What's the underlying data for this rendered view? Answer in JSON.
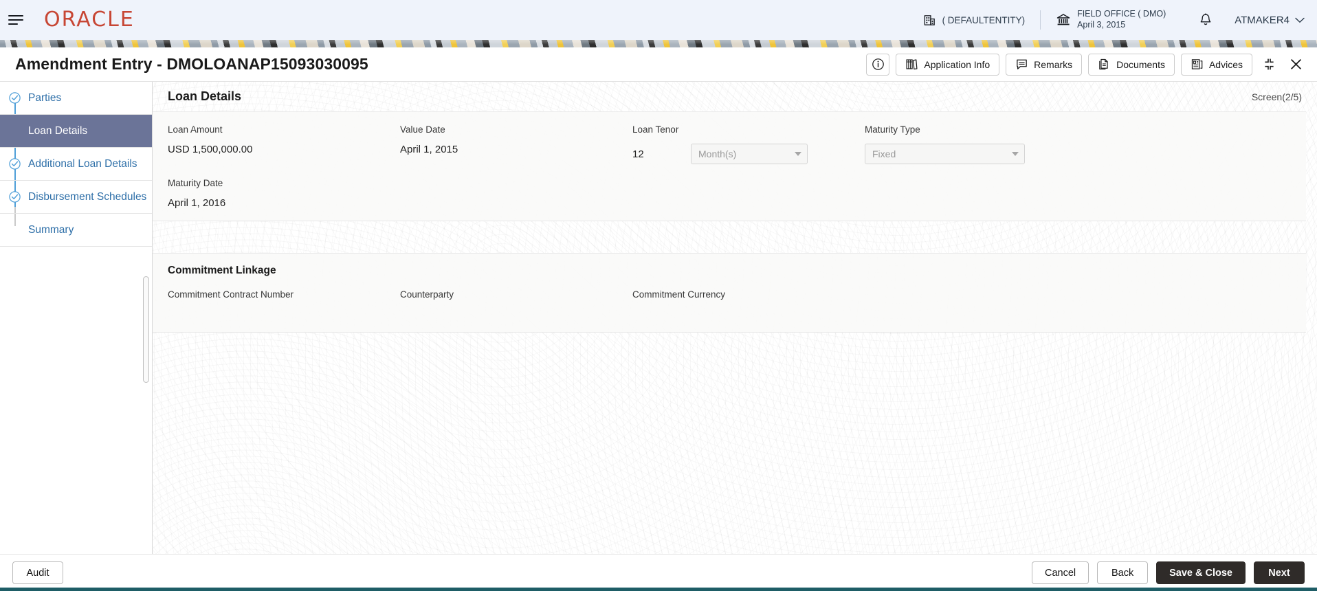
{
  "appbar": {
    "menu_icon": "hamburger-icon",
    "logo_text": "ORACLE",
    "entity": {
      "icon": "building-icon",
      "label": "( DEFAULTENTITY)"
    },
    "office": {
      "icon": "bank-icon",
      "name": "FIELD OFFICE ( DMO)",
      "date": "April 3, 2015"
    },
    "notifications_icon": "bell-icon",
    "user": {
      "name": "ATMAKER4",
      "caret_icon": "chevron-down-icon"
    }
  },
  "titlebar": {
    "title": "Amendment Entry - DMOLOANAP15093030095",
    "actions": [
      {
        "id": "info",
        "label": "",
        "icon": "info-circle-icon"
      },
      {
        "id": "application-info",
        "label": "Application Info",
        "icon": "books-icon"
      },
      {
        "id": "remarks",
        "label": "Remarks",
        "icon": "comment-icon"
      },
      {
        "id": "documents",
        "label": "Documents",
        "icon": "documents-icon"
      },
      {
        "id": "advices",
        "label": "Advices",
        "icon": "advices-icon"
      }
    ],
    "minimize_icon": "collapse-corners-icon",
    "close_icon": "close-icon"
  },
  "sidebar": {
    "items": [
      {
        "label": "Parties",
        "state": "complete"
      },
      {
        "label": "Loan Details",
        "state": "active"
      },
      {
        "label": "Additional Loan Details",
        "state": "complete"
      },
      {
        "label": "Disbursement Schedules",
        "state": "complete"
      },
      {
        "label": "Summary",
        "state": "pending"
      }
    ]
  },
  "main": {
    "section_title": "Loan Details",
    "screen_indicator": "Screen(2/5)",
    "loan_details": {
      "fields": [
        {
          "label": "Loan Amount",
          "value": "USD 1,500,000.00"
        },
        {
          "label": "Value Date",
          "value": "April 1, 2015"
        },
        {
          "label": "Loan Tenor",
          "value": "12",
          "unit_select": "Month(s)"
        },
        {
          "label": "Maturity Type",
          "select": "Fixed"
        },
        {
          "label": "Maturity Date",
          "value": "April 1, 2016"
        }
      ]
    },
    "commitment_linkage": {
      "heading": "Commitment Linkage",
      "fields": [
        {
          "label": "Commitment Contract Number",
          "value": ""
        },
        {
          "label": "Counterparty",
          "value": ""
        },
        {
          "label": "Commitment Currency",
          "value": ""
        }
      ]
    }
  },
  "footer": {
    "audit_label": "Audit",
    "cancel_label": "Cancel",
    "back_label": "Back",
    "save_close_label": "Save & Close",
    "next_label": "Next"
  },
  "colors": {
    "oracle_red": "#c74634",
    "appbar_bg": "#eff3fb",
    "active_nav_bg": "#6b7498",
    "link_blue": "#2e6fa8",
    "rail_blue": "#4f9fd8",
    "primary_button": "#2f2b29",
    "teal_accent": "#1e5d66"
  }
}
